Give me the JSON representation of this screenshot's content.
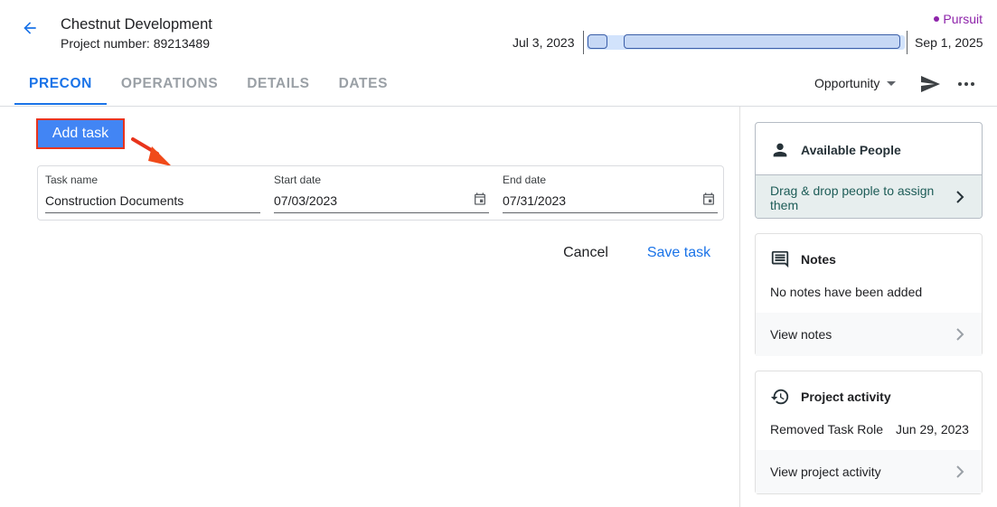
{
  "header": {
    "title": "Chestnut Development",
    "project_number": "Project number: 89213489",
    "status": "Pursuit",
    "date_start": "Jul 3, 2023",
    "date_end": "Sep 1, 2025"
  },
  "tabs": [
    {
      "label": "PRECON"
    },
    {
      "label": "OPERATIONS"
    },
    {
      "label": "DETAILS"
    },
    {
      "label": "DATES"
    }
  ],
  "toolbar": {
    "stage_select": "Opportunity"
  },
  "main": {
    "add_task_label": "Add task",
    "form": {
      "task_name_label": "Task name",
      "task_name_value": "Construction Documents",
      "start_date_label": "Start date",
      "start_date_value": "07/03/2023",
      "end_date_label": "End date",
      "end_date_value": "07/31/2023"
    },
    "cancel_label": "Cancel",
    "save_label": "Save task"
  },
  "sidebar": {
    "people": {
      "title": "Available People",
      "drag_hint": "Drag & drop people to assign them"
    },
    "notes": {
      "title": "Notes",
      "empty_text": "No notes have been added",
      "view_label": "View notes"
    },
    "activity": {
      "title": "Project activity",
      "entry_text": "Removed Task Role",
      "entry_date": "Jun 29, 2023",
      "view_label": "View project activity"
    }
  },
  "colors": {
    "accent": "#1a73e8",
    "primary_button": "#4285f4",
    "status": "#8e24aa",
    "highlight": "#e8341c"
  },
  "icons": [
    "arrow-back-icon",
    "send-icon",
    "more-horiz-icon",
    "calendar-icon",
    "person-icon",
    "chevron-right-icon",
    "notes-icon",
    "history-icon"
  ]
}
